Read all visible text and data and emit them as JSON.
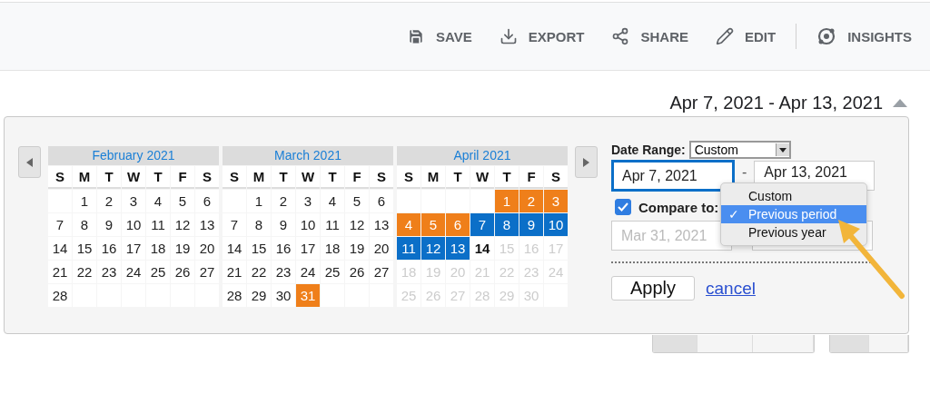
{
  "toolbar": {
    "items": [
      {
        "kind": "save",
        "label": "SAVE"
      },
      {
        "kind": "export",
        "label": "EXPORT"
      },
      {
        "kind": "share",
        "label": "SHARE"
      },
      {
        "kind": "edit",
        "label": "EDIT"
      },
      {
        "kind": "insights",
        "label": "INSIGHTS"
      }
    ]
  },
  "date_range_title": "Apr 7, 2021 - Apr 13, 2021",
  "calendar": {
    "months": [
      {
        "title": "February 2021",
        "weekdays": [
          "S",
          "M",
          "T",
          "W",
          "T",
          "F",
          "S"
        ],
        "weeks": [
          [
            {
              "kind": "blank"
            },
            {
              "day": "1",
              "kind": "plain"
            },
            {
              "day": "2",
              "kind": "plain"
            },
            {
              "day": "3",
              "kind": "plain"
            },
            {
              "day": "4",
              "kind": "plain"
            },
            {
              "day": "5",
              "kind": "plain"
            },
            {
              "day": "6",
              "kind": "plain"
            }
          ],
          [
            {
              "day": "7",
              "kind": "plain"
            },
            {
              "day": "8",
              "kind": "plain"
            },
            {
              "day": "9",
              "kind": "plain"
            },
            {
              "day": "10",
              "kind": "plain"
            },
            {
              "day": "11",
              "kind": "plain"
            },
            {
              "day": "12",
              "kind": "plain"
            },
            {
              "day": "13",
              "kind": "plain"
            }
          ],
          [
            {
              "day": "14",
              "kind": "plain"
            },
            {
              "day": "15",
              "kind": "plain"
            },
            {
              "day": "16",
              "kind": "plain"
            },
            {
              "day": "17",
              "kind": "plain"
            },
            {
              "day": "18",
              "kind": "plain"
            },
            {
              "day": "19",
              "kind": "plain"
            },
            {
              "day": "20",
              "kind": "plain"
            }
          ],
          [
            {
              "day": "21",
              "kind": "plain"
            },
            {
              "day": "22",
              "kind": "plain"
            },
            {
              "day": "23",
              "kind": "plain"
            },
            {
              "day": "24",
              "kind": "plain"
            },
            {
              "day": "25",
              "kind": "plain"
            },
            {
              "day": "26",
              "kind": "plain"
            },
            {
              "day": "27",
              "kind": "plain"
            }
          ],
          [
            {
              "day": "28",
              "kind": "plain"
            },
            {
              "kind": "blank"
            },
            {
              "kind": "blank"
            },
            {
              "kind": "blank"
            },
            {
              "kind": "blank"
            },
            {
              "kind": "blank"
            },
            {
              "kind": "blank"
            }
          ]
        ]
      },
      {
        "title": "March 2021",
        "weekdays": [
          "S",
          "M",
          "T",
          "W",
          "T",
          "F",
          "S"
        ],
        "weeks": [
          [
            {
              "kind": "blank"
            },
            {
              "day": "1",
              "kind": "plain"
            },
            {
              "day": "2",
              "kind": "plain"
            },
            {
              "day": "3",
              "kind": "plain"
            },
            {
              "day": "4",
              "kind": "plain"
            },
            {
              "day": "5",
              "kind": "plain"
            },
            {
              "day": "6",
              "kind": "plain"
            }
          ],
          [
            {
              "day": "7",
              "kind": "plain"
            },
            {
              "day": "8",
              "kind": "plain"
            },
            {
              "day": "9",
              "kind": "plain"
            },
            {
              "day": "10",
              "kind": "plain"
            },
            {
              "day": "11",
              "kind": "plain"
            },
            {
              "day": "12",
              "kind": "plain"
            },
            {
              "day": "13",
              "kind": "plain"
            }
          ],
          [
            {
              "day": "14",
              "kind": "plain"
            },
            {
              "day": "15",
              "kind": "plain"
            },
            {
              "day": "16",
              "kind": "plain"
            },
            {
              "day": "17",
              "kind": "plain"
            },
            {
              "day": "18",
              "kind": "plain"
            },
            {
              "day": "19",
              "kind": "plain"
            },
            {
              "day": "20",
              "kind": "plain"
            }
          ],
          [
            {
              "day": "21",
              "kind": "plain"
            },
            {
              "day": "22",
              "kind": "plain"
            },
            {
              "day": "23",
              "kind": "plain"
            },
            {
              "day": "24",
              "kind": "plain"
            },
            {
              "day": "25",
              "kind": "plain"
            },
            {
              "day": "26",
              "kind": "plain"
            },
            {
              "day": "27",
              "kind": "plain"
            }
          ],
          [
            {
              "day": "28",
              "kind": "plain"
            },
            {
              "day": "29",
              "kind": "plain"
            },
            {
              "day": "30",
              "kind": "plain"
            },
            {
              "day": "31",
              "kind": "compare"
            },
            {
              "kind": "blank"
            },
            {
              "kind": "blank"
            },
            {
              "kind": "blank"
            }
          ]
        ]
      },
      {
        "title": "April 2021",
        "weekdays": [
          "S",
          "M",
          "T",
          "W",
          "T",
          "F",
          "S"
        ],
        "weeks": [
          [
            {
              "kind": "blank"
            },
            {
              "kind": "blank"
            },
            {
              "kind": "blank"
            },
            {
              "kind": "blank"
            },
            {
              "day": "1",
              "kind": "compare"
            },
            {
              "day": "2",
              "kind": "compare"
            },
            {
              "day": "3",
              "kind": "compare"
            }
          ],
          [
            {
              "day": "4",
              "kind": "compare"
            },
            {
              "day": "5",
              "kind": "compare"
            },
            {
              "day": "6",
              "kind": "compare"
            },
            {
              "day": "7",
              "kind": "range"
            },
            {
              "day": "8",
              "kind": "range"
            },
            {
              "day": "9",
              "kind": "range"
            },
            {
              "day": "10",
              "kind": "range"
            }
          ],
          [
            {
              "day": "11",
              "kind": "range"
            },
            {
              "day": "12",
              "kind": "range"
            },
            {
              "day": "13",
              "kind": "range"
            },
            {
              "day": "14",
              "kind": "today"
            },
            {
              "day": "15",
              "kind": "future"
            },
            {
              "day": "16",
              "kind": "future"
            },
            {
              "day": "17",
              "kind": "future"
            }
          ],
          [
            {
              "day": "18",
              "kind": "future"
            },
            {
              "day": "19",
              "kind": "future"
            },
            {
              "day": "20",
              "kind": "future"
            },
            {
              "day": "21",
              "kind": "future"
            },
            {
              "day": "22",
              "kind": "future"
            },
            {
              "day": "23",
              "kind": "future"
            },
            {
              "day": "24",
              "kind": "future"
            }
          ],
          [
            {
              "day": "25",
              "kind": "future"
            },
            {
              "day": "26",
              "kind": "future"
            },
            {
              "day": "27",
              "kind": "future"
            },
            {
              "day": "28",
              "kind": "future"
            },
            {
              "day": "29",
              "kind": "future"
            },
            {
              "day": "30",
              "kind": "future"
            },
            {
              "kind": "blank"
            }
          ]
        ]
      }
    ]
  },
  "form": {
    "date_range_label": "Date Range:",
    "date_range_value": "Custom",
    "start": "Apr 7, 2021",
    "separator": "-",
    "end": "Apr 13, 2021",
    "compare": {
      "label": "Compare to:",
      "checked": true
    },
    "compare_start": "Mar 31, 2021",
    "apply": "Apply",
    "cancel": "cancel"
  },
  "compare_menu": {
    "check_mark": "✓",
    "options": [
      {
        "label": "Custom",
        "selected": false
      },
      {
        "label": "Previous period",
        "selected": true
      },
      {
        "label": "Previous year",
        "selected": false
      }
    ]
  }
}
